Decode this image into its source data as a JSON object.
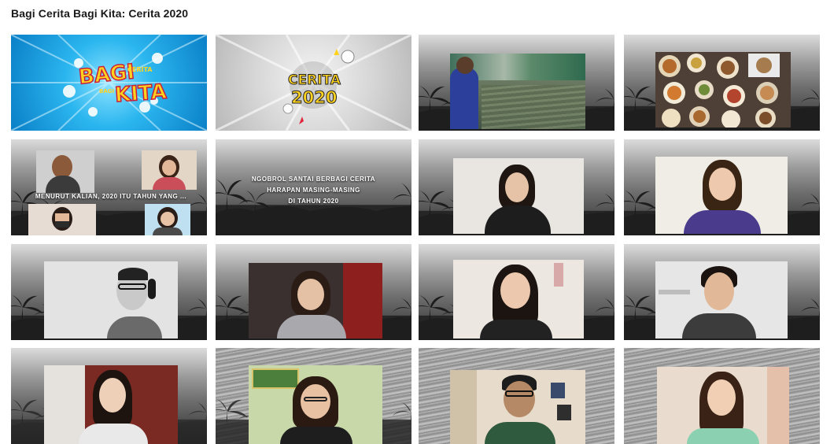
{
  "header": {
    "title": "Bagi Cerita Bagi Kita: Cerita 2020"
  },
  "tiles": {
    "t1": {
      "logo_big_1": "BAGI",
      "logo_small_1": "CERITA",
      "logo_small_2": "BAGI",
      "logo_big_2": "KITA"
    },
    "t2": {
      "logo_line_1": "CERITA",
      "logo_line_2": "2020"
    },
    "t5": {
      "caption": "MENURUT KALIAN, 2020 ITU TAHUN YANG ..."
    },
    "t6": {
      "caption_line_1": "NGOBROL SANTAI BERBAGI CERITA",
      "caption_line_2": "HARAPAN MASING-MASING",
      "caption_line_3": "DI TAHUN 2020"
    }
  }
}
